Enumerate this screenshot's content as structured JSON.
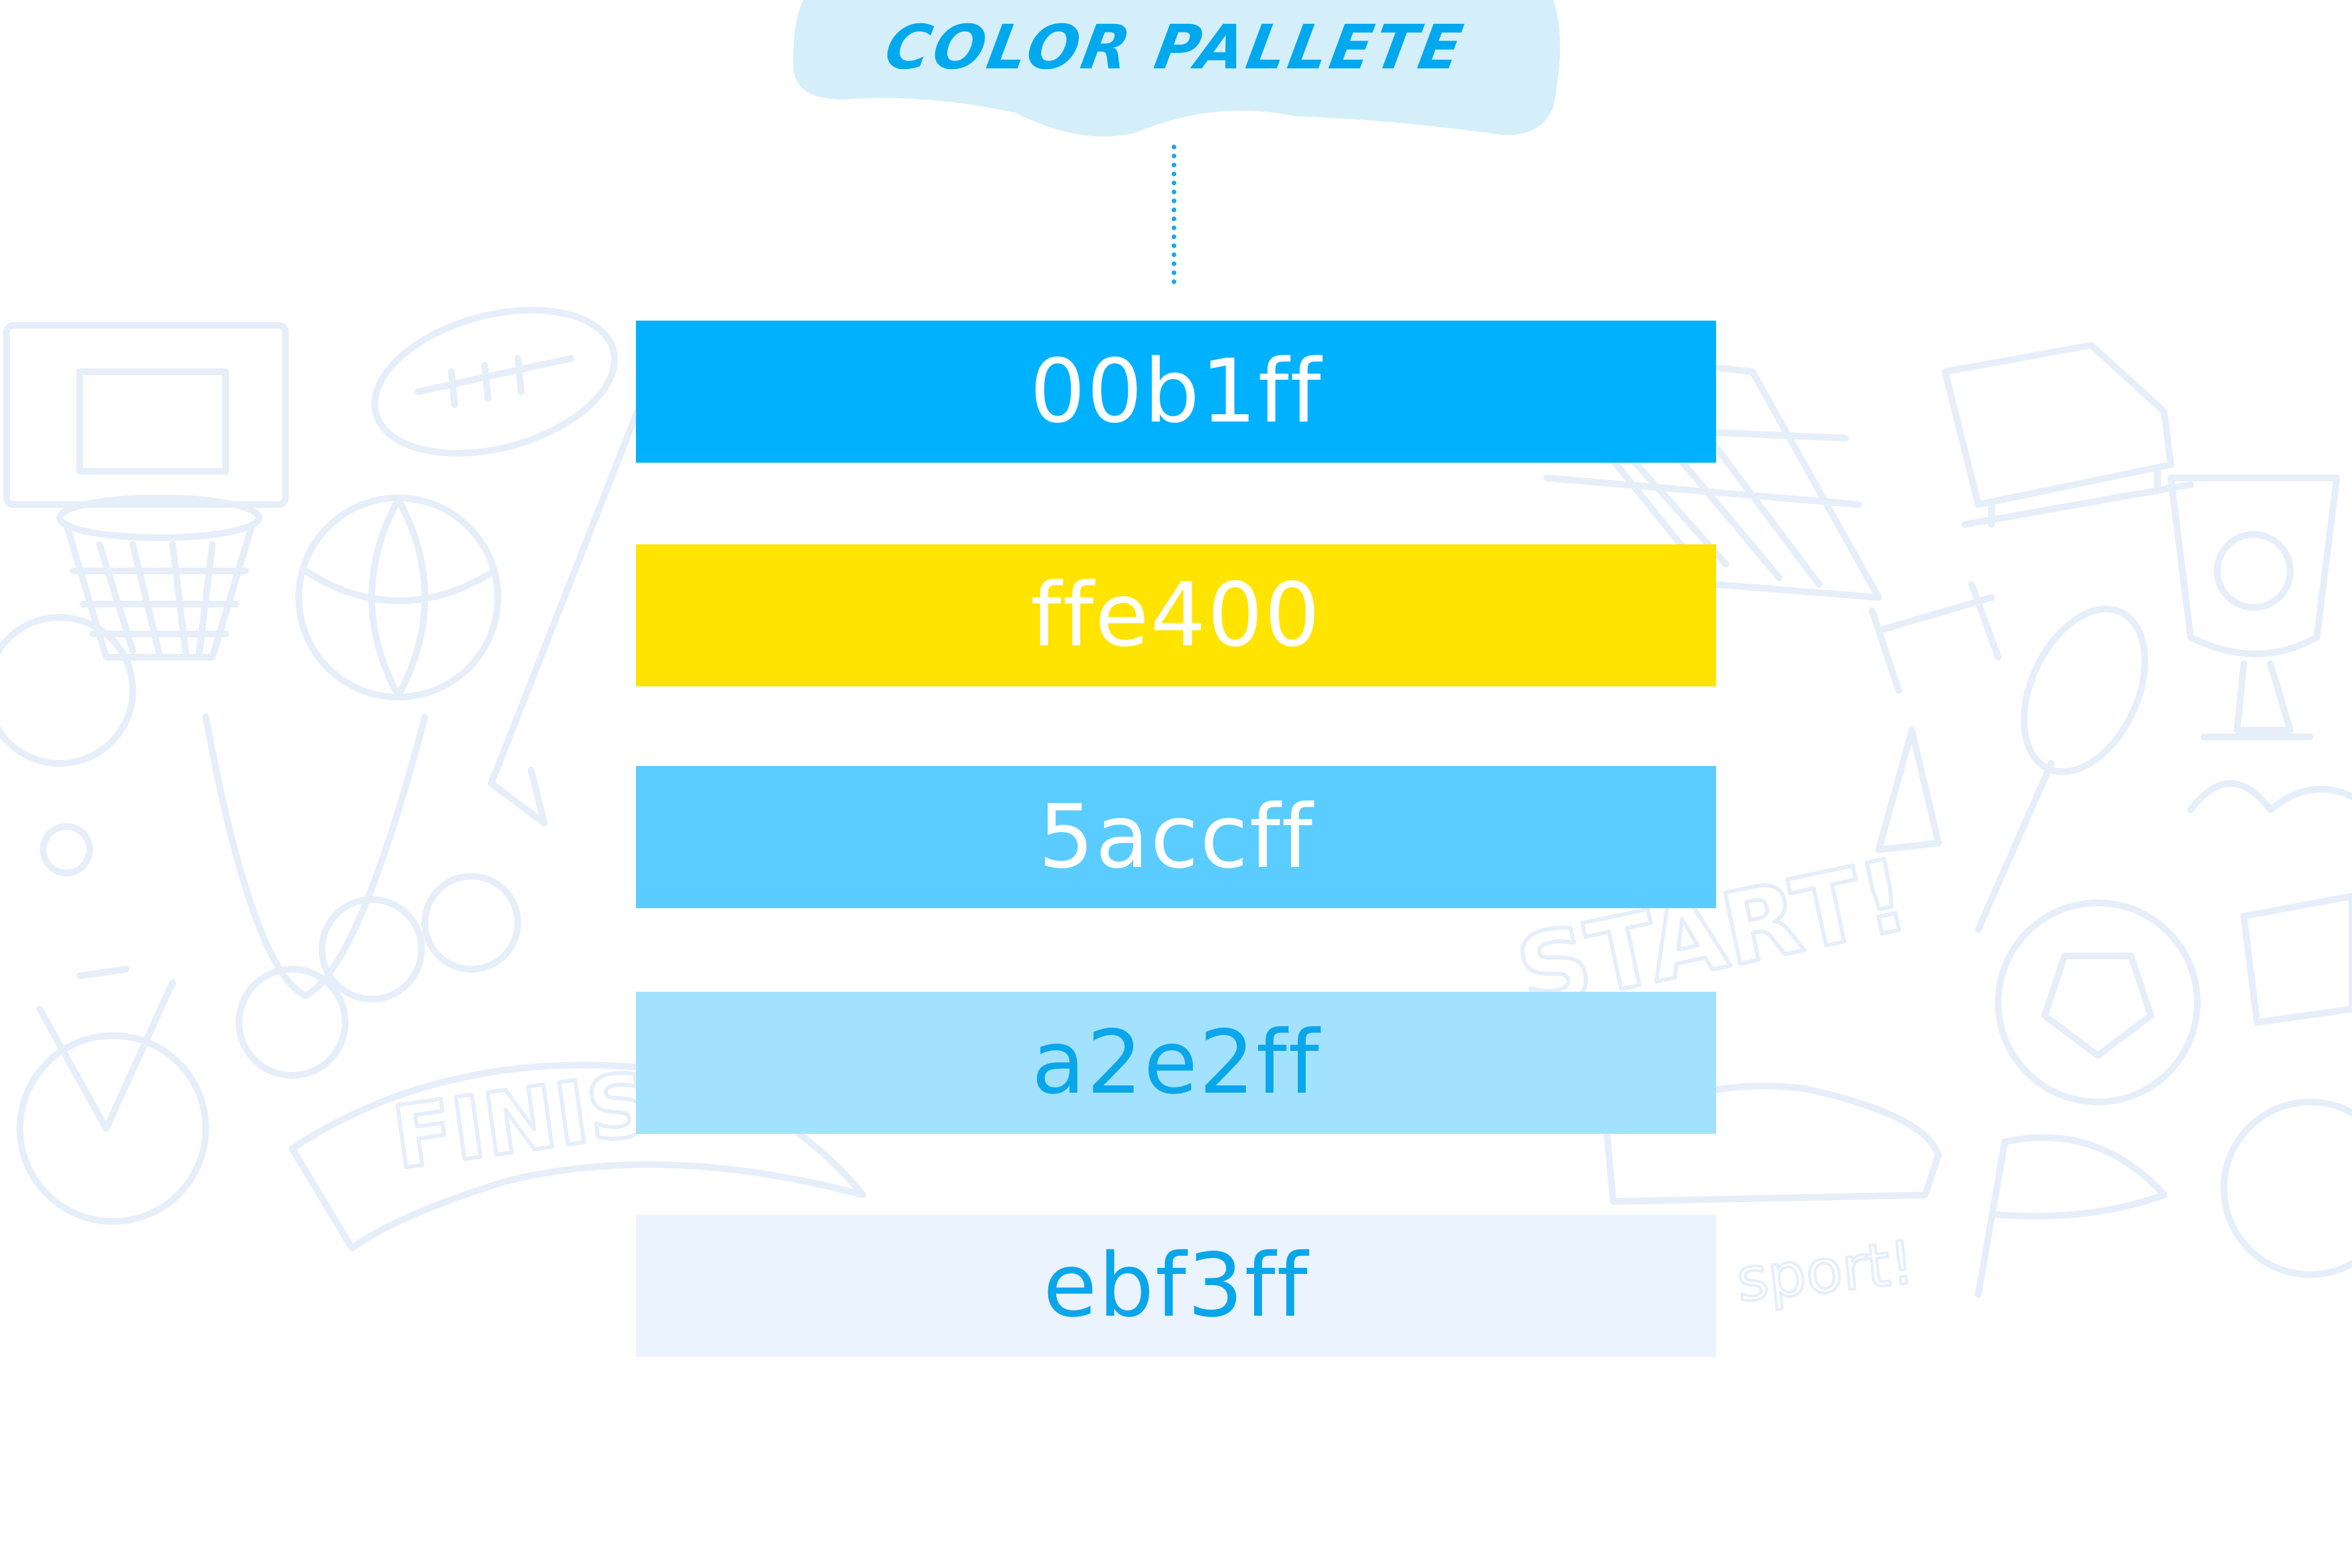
{
  "title": "COLOR PALLETE",
  "title_color": "#00a8ee",
  "title_blob_color": "#d4effa",
  "background_color": "#ffffff",
  "doodle_stroke_color": "#e6eef9",
  "doodle_texts": [
    "FINISH",
    "START!",
    "sport!"
  ],
  "swatches": [
    {
      "label": "00b1ff",
      "fill": "#00b1ff",
      "text_color": "#ffffff"
    },
    {
      "label": "ffe400",
      "fill": "#ffe400",
      "text_color": "#ffffff"
    },
    {
      "label": "5accff",
      "fill": "#5accff",
      "text_color": "#ffffff"
    },
    {
      "label": "a2e2ff",
      "fill": "#a2e2ff",
      "text_color": "#0aa6ea"
    },
    {
      "label": "ebf3ff",
      "fill": "#ebf3ff",
      "text_color": "#0aa6ea"
    }
  ]
}
